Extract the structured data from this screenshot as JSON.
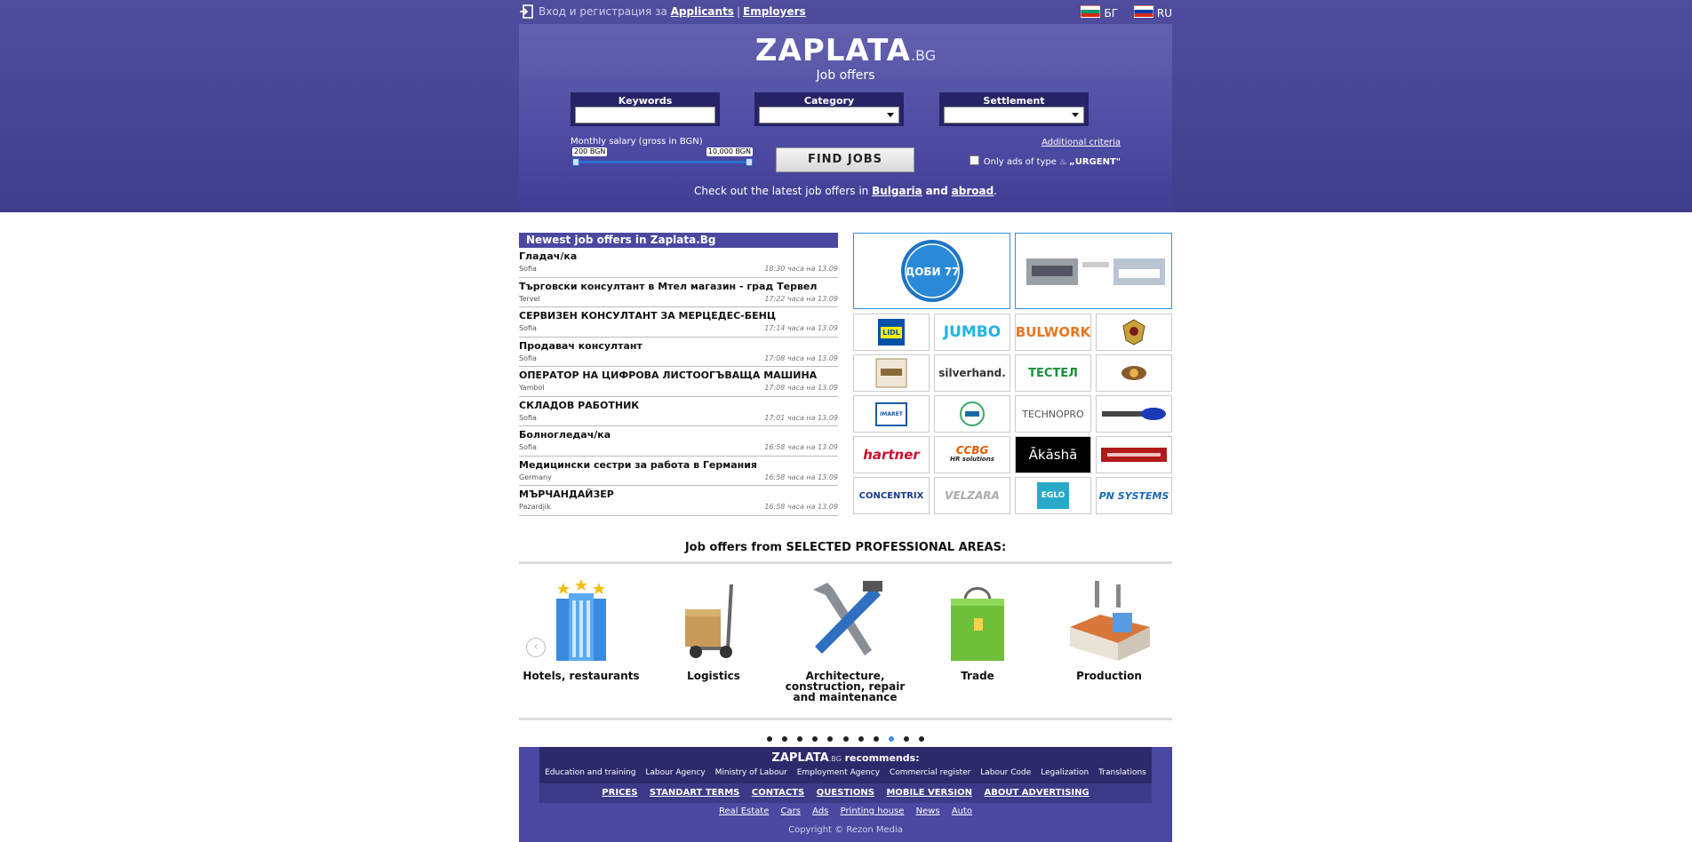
{
  "topbar": {
    "login_prefix": "Вход и регистрация за",
    "applicants": "Applicants",
    "separator": "|",
    "employers": "Employers",
    "lang_bg": "БГ",
    "lang_ru": "RU"
  },
  "search": {
    "logo": "ZAPLATA",
    "logo_suffix": ".BG",
    "subtitle": "Job offers",
    "keywords_label": "Keywords",
    "category_label": "Category",
    "settlement_label": "Settlement",
    "keywords_value": "",
    "category_value": "",
    "settlement_value": "",
    "salary_label": "Monthly salary (gross in BGN)",
    "salary_min": "200 BGN",
    "salary_max": "10,000 BGN",
    "find_button": "FIND JOBS",
    "additional_criteria": "Additional criteria",
    "urgent_prefix": "Only ads of type",
    "urgent_badge": "„URGENT\"",
    "latest_prefix": "Check out the latest job offers in",
    "latest_bulgaria": "Bulgaria",
    "latest_and": "and",
    "latest_abroad": "abroad",
    "latest_suffix": "."
  },
  "jobs": {
    "title": "Newest job offers in Zaplata.Bg",
    "items": [
      {
        "title": "Гладач/ка",
        "city": "Sofia",
        "time": "18:30 часа на 13.09"
      },
      {
        "title": "Търговски консултант в Мтел магазин - град Тервел",
        "city": "Tervel",
        "time": "17:22 часа на 13.09"
      },
      {
        "title": "СЕРВИЗЕН КОНСУЛТАНТ ЗА МЕРЦЕДЕС-БЕНЦ",
        "city": "Sofia",
        "time": "17:14 часа на 13.09"
      },
      {
        "title": "Продавач консултант",
        "city": "Sofia",
        "time": "17:08 часа на 13.09"
      },
      {
        "title": "ОПЕРАТОР НА ЦИФРОВА ЛИСТООГЪВАЩА МАШИНА",
        "city": "Yambol",
        "time": "17:08 часа на 13.09"
      },
      {
        "title": "СКЛАДОВ РАБОТНИК",
        "city": "Sofia",
        "time": "17:01 часа на 13.09"
      },
      {
        "title": "Болногледач/ка",
        "city": "Sofia",
        "time": "16:58 часа на 13.09"
      },
      {
        "title": "Медицински сестри за работа в Германия",
        "city": "Germany",
        "time": "16:58 часа на 13.09"
      },
      {
        "title": "МЪРЧАНДАЙЗЕР",
        "city": "Pazardjik",
        "time": "16:58 часа на 13.09"
      }
    ]
  },
  "logos": {
    "dobi_text": "ДОБИ 77",
    "lidl": "LIDL",
    "jumbo": "JUMBO",
    "bulwork": "BULWORK",
    "silverhand": "silverhand.",
    "testel": "ТЕСТЕЛ",
    "technopro": "TECHNOPRO",
    "hartner": "hartner",
    "ccbg": "CCBG",
    "ccbg_sub": "HR solutions",
    "aakasha": "Ākāshā",
    "concentrix": "CONCENTRIX",
    "eglo": "EGLO",
    "pnsystems": "PN SYSTEMS",
    "imaret": "IMARET",
    "velzara": "VELZARA"
  },
  "areas": {
    "title": "Job offers from SELECTED PROFESSIONAL AREAS:",
    "prev": "‹",
    "items": [
      {
        "label": "Hotels, restaurants"
      },
      {
        "label": "Logistics"
      },
      {
        "label": "Architecture, construction, repair and maintenance"
      },
      {
        "label": "Trade"
      },
      {
        "label": "Production"
      }
    ]
  },
  "footer": {
    "rec_logo": "ZAPLATA",
    "rec_logo_suffix": ".BG",
    "rec_text": "recommends:",
    "rec_links": [
      "Education and training",
      "Labour Agency",
      "Ministry of Labour",
      "Employment Agency",
      "Commercial register",
      "Labour Code",
      "Legalization",
      "Translations"
    ],
    "nav": [
      "PRICES",
      "STANDART TERMS",
      "CONTACTS",
      "QUESTIONS",
      "MOBILE VERSION",
      "ABOUT ADVERTISING"
    ],
    "links": [
      "Real Estate",
      "Cars",
      "Ads",
      "Printing house",
      "News",
      "Auto"
    ],
    "copyright": "Copyright © Rezon Media"
  },
  "colors": {
    "header_bg": "#4f4d9d",
    "field_bg": "#262366",
    "accent_blue": "#2f8fe8",
    "footer_bg": "#4a48a0"
  }
}
